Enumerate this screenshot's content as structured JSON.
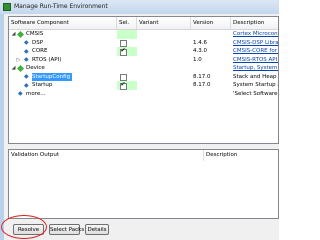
{
  "window": {
    "title": "Manage Run-Time Environment"
  },
  "grid": {
    "columns": [
      "Software Component",
      "Sel.",
      "Variant",
      "Version",
      "Description"
    ],
    "rows": [
      {
        "name": "CMSIS",
        "level": 0,
        "expanded": true,
        "icon": "green-gem-icon",
        "sel": null,
        "variant": "",
        "version": "",
        "description": "Cortex Microcontroller Softwa",
        "link": true,
        "selected": false,
        "green": true
      },
      {
        "name": "DSP",
        "level": 1,
        "icon": "blue-diamond-icon",
        "sel": false,
        "variant": "",
        "version": "1.4.6",
        "description": "CMSIS-DSP Library for Cor",
        "link": true,
        "selected": false,
        "green": false
      },
      {
        "name": "CORE",
        "level": 1,
        "icon": "blue-diamond-icon",
        "sel": true,
        "variant": "",
        "version": "4.3.0",
        "description": "CMSIS-CORE for Cortex-M",
        "link": true,
        "selected": false,
        "green": true
      },
      {
        "name": "RTOS (API)",
        "level": 1,
        "expanded": false,
        "icon": "blue-diamond-icon",
        "sel": null,
        "variant": "",
        "version": "1.0",
        "description": "CMSIS-RTOS API for Cortex",
        "link": true,
        "selected": false,
        "green": false
      },
      {
        "name": "Device",
        "level": 0,
        "expanded": true,
        "icon": "green-gem-icon",
        "sel": null,
        "variant": "",
        "version": "",
        "description": "Startup, System Setup",
        "link": true,
        "selected": false,
        "green": false
      },
      {
        "name": "StartupConfig",
        "level": 1,
        "icon": "blue-diamond-icon",
        "sel": false,
        "variant": "",
        "version": "8.17.0",
        "description": "Stack and Heap configuration",
        "link": false,
        "selected": true,
        "green": false
      },
      {
        "name": "Startup",
        "level": 1,
        "icon": "blue-diamond-icon",
        "sel": true,
        "variant": "",
        "version": "8.17.0",
        "description": "System Startup and System",
        "link": false,
        "selected": false,
        "green": true
      },
      {
        "name": "more...",
        "level": 0,
        "icon": "blue-diamond-icon",
        "sel": null,
        "variant": "",
        "version": "",
        "description": "'Select Software Packs' ...",
        "link": false,
        "selected": false,
        "green": false
      }
    ]
  },
  "validation": {
    "col1": "Validation Output",
    "col2": "Description"
  },
  "buttons": {
    "resolve": "Resolve",
    "select_packs": "Select Packs",
    "details": "Details"
  },
  "colors": {
    "selection": "#3399ff",
    "green_cell": "#c9ffc9",
    "annotation": "#e02020"
  }
}
